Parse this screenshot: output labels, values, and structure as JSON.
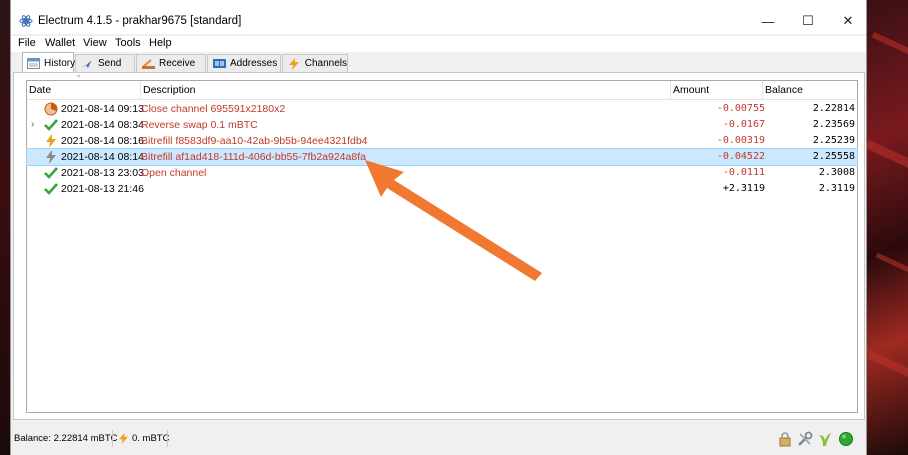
{
  "window": {
    "title": "Electrum 4.1.5  -  prakhar9675  [standard]",
    "controls": {
      "minimize": "—",
      "maximize": "☐",
      "close": "✕"
    }
  },
  "menu": [
    "File",
    "Wallet",
    "View",
    "Tools",
    "Help"
  ],
  "tabs": [
    {
      "label": "History",
      "icon": "history-icon",
      "active": true
    },
    {
      "label": "Send",
      "icon": "send-icon"
    },
    {
      "label": "Receive",
      "icon": "receive-icon"
    },
    {
      "label": "Addresses",
      "icon": "addresses-icon"
    },
    {
      "label": "Channels",
      "icon": "lightning-icon"
    }
  ],
  "history": {
    "columns": [
      "Date",
      "Description",
      "Amount",
      "Balance"
    ],
    "rows": [
      {
        "status_icon": "clock-pie-icon",
        "date": "2021-08-14 09:13",
        "description": "Close channel 695591x2180x2",
        "amount": "-0.00755",
        "balance": "2.22814",
        "expandable": false,
        "selected": false
      },
      {
        "status_icon": "checkmark-icon",
        "date": "2021-08-14 08:34",
        "description": "Reverse swap 0.1 mBTC",
        "amount": "-0.0167",
        "balance": "2.23569",
        "expandable": true,
        "selected": false
      },
      {
        "status_icon": "lightning-icon",
        "date": "2021-08-14 08:16",
        "description": "Bitrefill f8583df9-aa10-42ab-9b5b-94ee4321fdb4",
        "amount": "-0.00319",
        "balance": "2.25239",
        "expandable": false,
        "selected": false
      },
      {
        "status_icon": "lightning-icon",
        "date": "2021-08-14 08:14",
        "description": "Bitrefill af1ad418-111d-406d-bb55-7fb2a924a8fa",
        "amount": "-0.04522",
        "balance": "2.25558",
        "expandable": false,
        "selected": true
      },
      {
        "status_icon": "checkmark-icon",
        "date": "2021-08-13 23:03",
        "description": "Open channel",
        "amount": "-0.0111",
        "balance": "2.3008",
        "expandable": false,
        "selected": false
      },
      {
        "status_icon": "checkmark-icon",
        "date": "2021-08-13 21:46",
        "description": "",
        "amount": "+2.3119",
        "balance": "2.3119",
        "expandable": false,
        "selected": false
      }
    ]
  },
  "statusbar": {
    "balance": "Balance: 2.22814 mBTC",
    "lightning": "0. mBTC",
    "icons": [
      "lock-icon",
      "tools-icon",
      "seed-icon",
      "network-status-icon"
    ]
  },
  "colors": {
    "negative": "#c0392b",
    "selection": "#cce8ff",
    "annotation_arrow": "#f07830",
    "network_ok": "#2ea82e"
  }
}
